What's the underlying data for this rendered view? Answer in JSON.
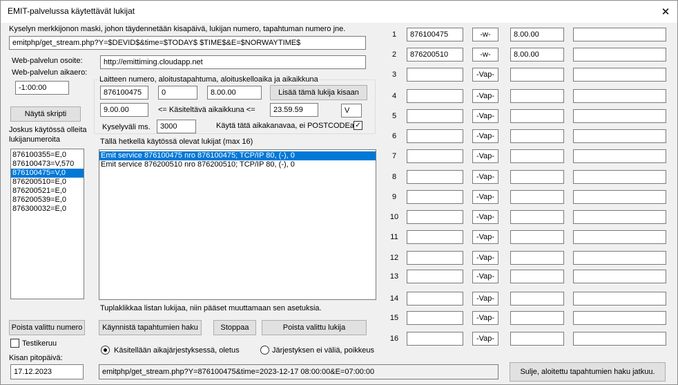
{
  "window": {
    "title": "EMIT-palvelussa käytettävät lukijat",
    "close": "✕"
  },
  "mask": {
    "label": "Kyselyn merkkijonon maski, johon täydennetään kisapäivä, lukijan numero, tapahtuman numero jne.",
    "value": "emitphp/get_stream.php?Y=$DEVID$&time=$TODAY$ $TIME$&E=$NORWAYTIME$"
  },
  "web": {
    "address_label": "Web-palvelun osoite:",
    "address_value": "http://emittiming.cloudapp.net",
    "offset_label": "Web-palvelun aikaero:",
    "offset_value": "-1:00:00"
  },
  "group": {
    "title": "Laitteen numero, aloitustapahtuma, aloituskelloaika ja aikaikkuna",
    "device": "876100475",
    "start_event": "0",
    "start_time": "8.00.00",
    "add_button": "Lisää tämä lukija kisaan",
    "window_start": "9.00.00",
    "window_label": "<= Käsiteltävä aikaikkuna <=",
    "window_end": "23.59.59",
    "v_value": "V",
    "interval_label": "Kyselyväli ms.",
    "interval_value": "3000",
    "timechannel_label": "Käytä tätä aikakanavaa, ei POSTCODEa",
    "timechannel_checked": "✓"
  },
  "show_script_button": "Näytä skripti",
  "old_readers": {
    "label": "Joskus käytössä olleita lukijanumeroita",
    "items": [
      "876100355=E,0",
      "876100473=V,570",
      "876100475=V,0",
      "876200510=E,0",
      "876200521=E,0",
      "876200539=E,0",
      "876300032=E,0"
    ],
    "selected_index": 2
  },
  "active": {
    "label": "Tällä hetkellä käytössä olevat lukijat (max 16)",
    "items": [
      "Emit service 876100475 nro 876100475; TCP/IP 80, (-), 0",
      "Emit service 876200510 nro 876200510; TCP/IP 80, (-), 0"
    ],
    "selected_index": 0,
    "hint": "Tuplaklikkaa listan lukijaa, niin pääset muuttamaan sen asetuksia."
  },
  "buttons": {
    "remove_number": "Poista valittu numero",
    "start_fetch": "Käynnistä tapahtumien haku",
    "stop": "Stoppaa",
    "remove_reader": "Poista valittu lukija",
    "close": "Sulje, aloitettu tapahtumien haku jatkuu."
  },
  "test": {
    "label": "Testikeruu",
    "checked": ""
  },
  "date": {
    "label": "Kisan pitopäivä:",
    "value": "17.12.2023"
  },
  "order": {
    "option1": "Käsitellään aikajärjestyksessä, oletus",
    "option2": "Järjestyksen ei väliä, poikkeus",
    "selected": 1
  },
  "status_text": "emitphp/get_stream.php?Y=876100475&time=2023-12-17 08:00:00&E=07:00:00",
  "rows": [
    {
      "n": "1",
      "a": "876100475",
      "b": "-w-",
      "c": "8.00.00",
      "d": ""
    },
    {
      "n": "2",
      "a": "876200510",
      "b": "-w-",
      "c": "8.00.00",
      "d": ""
    },
    {
      "n": "3",
      "a": "",
      "b": "-Vap-",
      "c": "",
      "d": ""
    },
    {
      "n": "4",
      "a": "",
      "b": "-Vap-",
      "c": "",
      "d": ""
    },
    {
      "n": "5",
      "a": "",
      "b": "-Vap-",
      "c": "",
      "d": ""
    },
    {
      "n": "6",
      "a": "",
      "b": "-Vap-",
      "c": "",
      "d": ""
    },
    {
      "n": "7",
      "a": "",
      "b": "-Vap-",
      "c": "",
      "d": ""
    },
    {
      "n": "8",
      "a": "",
      "b": "-Vap-",
      "c": "",
      "d": ""
    },
    {
      "n": "9",
      "a": "",
      "b": "-Vap-",
      "c": "",
      "d": ""
    },
    {
      "n": "10",
      "a": "",
      "b": "-Vap-",
      "c": "",
      "d": ""
    },
    {
      "n": "11",
      "a": "",
      "b": "-Vap-",
      "c": "",
      "d": ""
    },
    {
      "n": "12",
      "a": "",
      "b": "-Vap-",
      "c": "",
      "d": ""
    },
    {
      "n": "13",
      "a": "",
      "b": "-Vap-",
      "c": "",
      "d": ""
    },
    {
      "n": "14",
      "a": "",
      "b": "-Vap-",
      "c": "",
      "d": ""
    },
    {
      "n": "15",
      "a": "",
      "b": "-Vap-",
      "c": "",
      "d": ""
    },
    {
      "n": "16",
      "a": "",
      "b": "-Vap-",
      "c": "",
      "d": ""
    }
  ]
}
